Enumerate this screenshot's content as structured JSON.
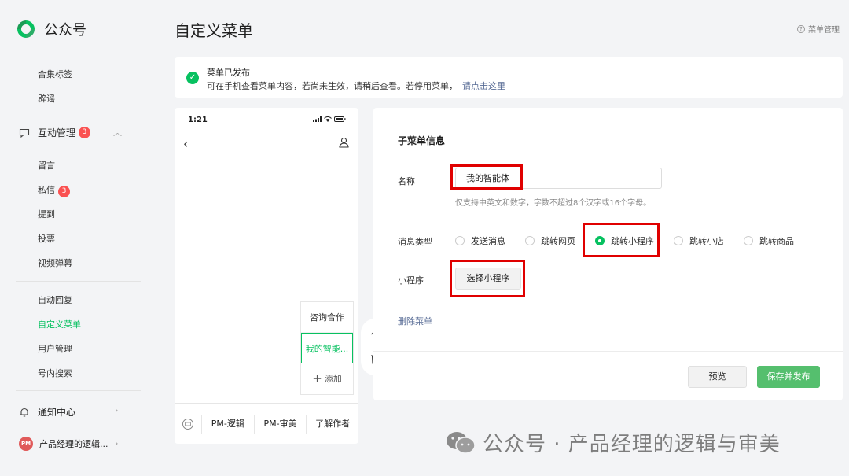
{
  "sidebar": {
    "logo_text": "公众号",
    "items_top": [
      "合集标签",
      "辟谣"
    ],
    "interaction": {
      "label": "互动管理",
      "badge": "3"
    },
    "interaction_items": [
      {
        "label": "留言"
      },
      {
        "label": "私信",
        "badge": "3"
      },
      {
        "label": "提到"
      },
      {
        "label": "投票"
      },
      {
        "label": "视频弹幕"
      }
    ],
    "menu_items": [
      "自动回复",
      "自定义菜单",
      "用户管理",
      "号内搜索"
    ],
    "notify": "通知中心",
    "account": "产品经理的逻辑..."
  },
  "header": {
    "title": "自定义菜单",
    "help": "菜单管理"
  },
  "notice": {
    "title": "菜单已发布",
    "body": "可在手机查看菜单内容，若尚未生效，请稍后查看。若停用菜单，",
    "link": "请点击这里"
  },
  "phone": {
    "time": "1:21",
    "submenu": [
      "咨询合作",
      "我的智能...",
      "添加"
    ],
    "bottom_menu": [
      "PM-逻辑",
      "PM-审美",
      "了解作者"
    ]
  },
  "form": {
    "section_title": "子菜单信息",
    "name_label": "名称",
    "name_value": "我的智能体",
    "name_hint": "仅支持中英文和数字，字数不超过8个汉字或16个字母。",
    "type_label": "消息类型",
    "types": [
      "发送消息",
      "跳转网页",
      "跳转小程序",
      "跳转小店",
      "跳转商品"
    ],
    "selected_type": "跳转小程序",
    "mini_label": "小程序",
    "mini_button": "选择小程序",
    "delete_link": "删除菜单",
    "preview_button": "预览",
    "save_button": "保存并发布"
  },
  "watermark": "公众号 · 产品经理的逻辑与审美",
  "colors": {
    "accent": "#07c160",
    "link": "#576b95",
    "highlight": "#e00000"
  }
}
